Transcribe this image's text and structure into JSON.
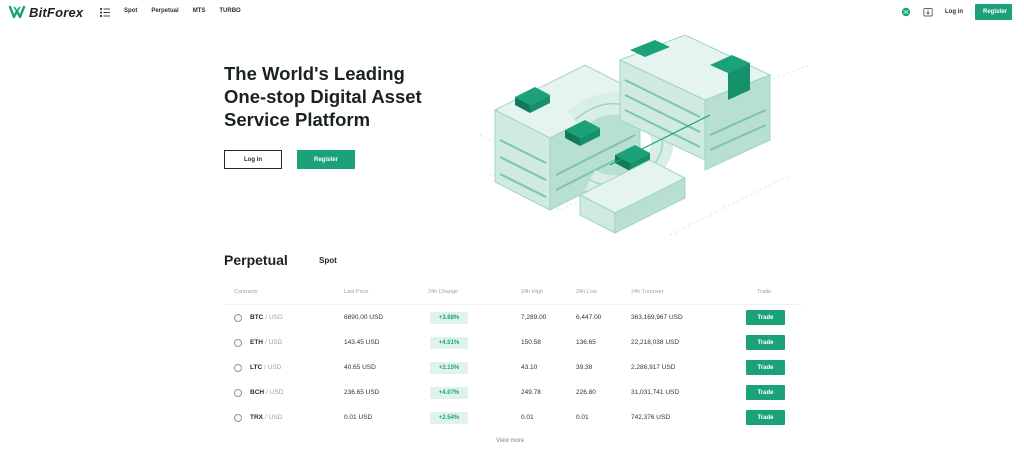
{
  "header": {
    "brand": "BitForex",
    "nav": [
      "Spot",
      "Perpetual",
      "MTS",
      "TURBO"
    ],
    "login_label": "Log in",
    "register_label": "Register",
    "icons": [
      "apps-grid-icon",
      "globe-icon",
      "download-icon"
    ]
  },
  "hero": {
    "title_lines": [
      "The World's Leading",
      "One-stop Digital Asset",
      "Service Platform"
    ],
    "login_label": "Log in",
    "register_label": "Register"
  },
  "market": {
    "tabs": [
      "Perpetual",
      "Spot"
    ],
    "active_tab": "Perpetual",
    "columns": [
      "Contracts",
      "Last Price",
      "24h Change",
      "24h High",
      "24h Low",
      "24h Turnover",
      "Trade"
    ],
    "rows": [
      {
        "coin": "BTC",
        "quote": "/ USD",
        "last": "6890.00 USD",
        "change": "+3.68%",
        "high": "7,289.00",
        "low": "6,447.00",
        "turnover": "363,169,967 USD",
        "trade": "Trade",
        "icon": "btc-icon"
      },
      {
        "coin": "ETH",
        "quote": "/ USD",
        "last": "143.45 USD",
        "change": "+4.51%",
        "high": "150.58",
        "low": "136.65",
        "turnover": "22,218,038 USD",
        "trade": "Trade",
        "icon": "eth-icon"
      },
      {
        "coin": "LTC",
        "quote": "/ USD",
        "last": "40.65 USD",
        "change": "+2.15%",
        "high": "43.10",
        "low": "39.38",
        "turnover": "2,286,917 USD",
        "trade": "Trade",
        "icon": "ltc-icon"
      },
      {
        "coin": "BCH",
        "quote": "/ USD",
        "last": "236.65 USD",
        "change": "+4.07%",
        "high": "249.78",
        "low": "226.80",
        "turnover": "31,031,741 USD",
        "trade": "Trade",
        "icon": "bch-icon"
      },
      {
        "coin": "TRX",
        "quote": "/ USD",
        "last": "0.01 USD",
        "change": "+2.54%",
        "high": "0.01",
        "low": "0.01",
        "turnover": "742,376 USD",
        "trade": "Trade",
        "icon": "trx-icon"
      }
    ],
    "view_more": "View more"
  },
  "colors": {
    "accent": "#1ba27a",
    "positive_bg": "#dff3ec",
    "text_dark": "#1b2226",
    "text_muted": "#9aa3a7"
  }
}
